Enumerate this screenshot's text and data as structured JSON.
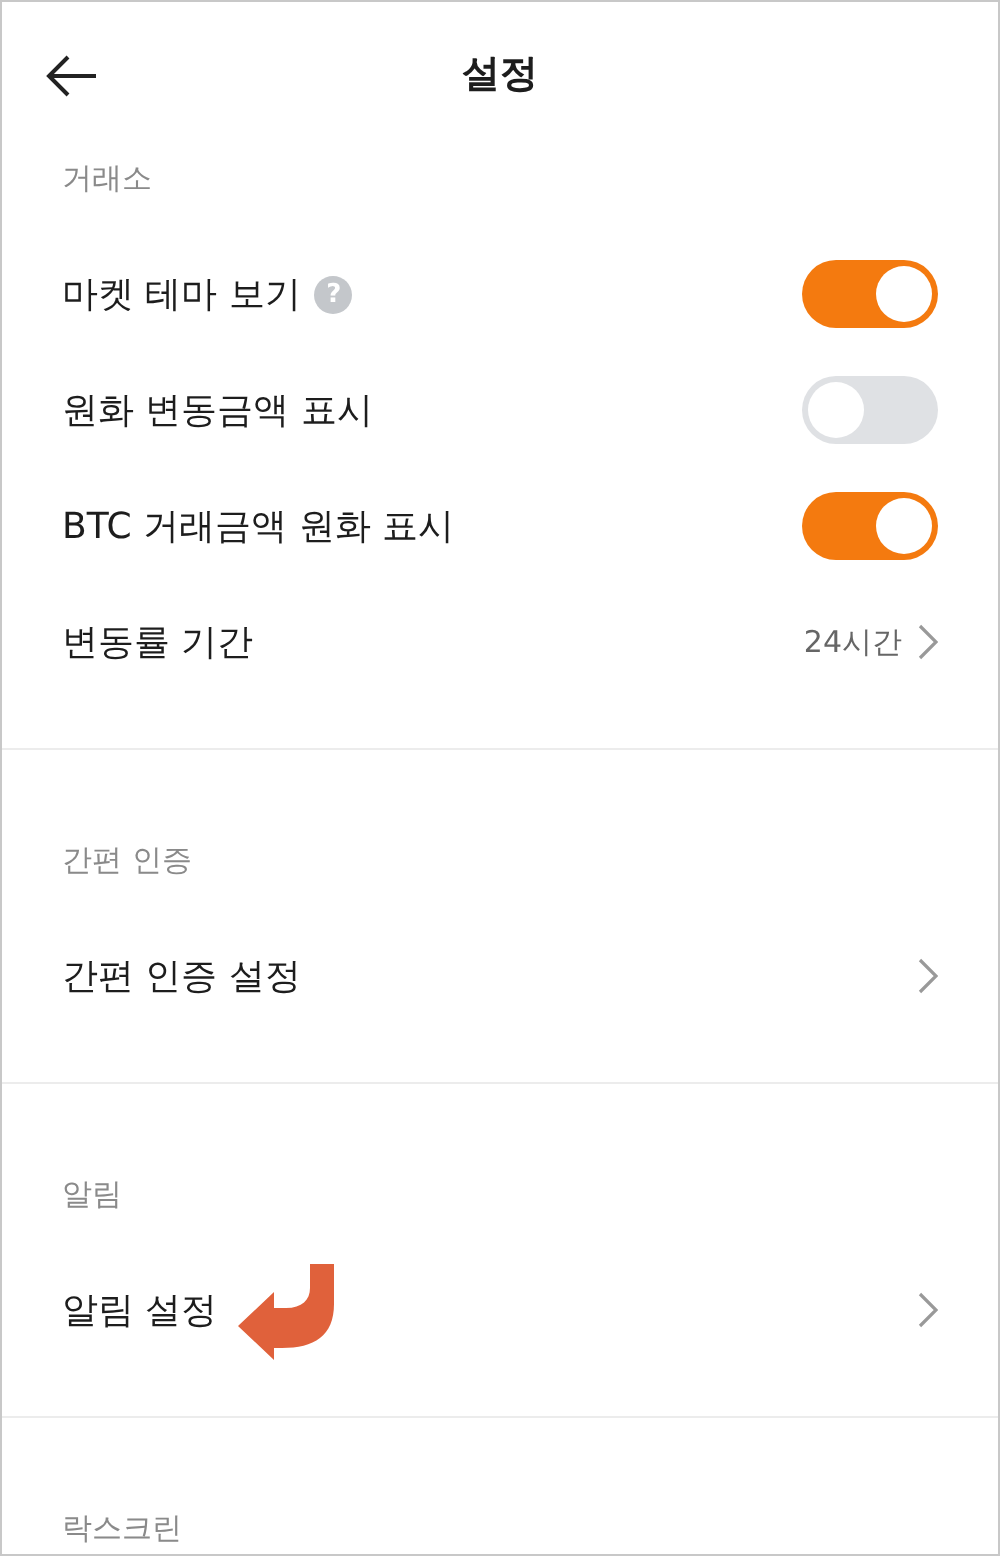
{
  "header": {
    "title": "설정"
  },
  "sections": [
    {
      "title": "거래소",
      "items": [
        {
          "kind": "toggle",
          "label": "마켓 테마 보기",
          "help": "?",
          "on": true
        },
        {
          "kind": "toggle",
          "label": "원화 변동금액 표시",
          "on": false
        },
        {
          "kind": "toggle",
          "label": "BTC 거래금액 원화 표시",
          "on": true
        },
        {
          "kind": "link",
          "label": "변동률 기간",
          "value": "24시간"
        }
      ]
    },
    {
      "title": "간편 인증",
      "items": [
        {
          "kind": "link",
          "label": "간편 인증 설정"
        }
      ]
    },
    {
      "title": "알림",
      "items": [
        {
          "kind": "link",
          "label": "알림 설정",
          "annotated": true
        }
      ]
    },
    {
      "title": "락스크린"
    }
  ]
}
